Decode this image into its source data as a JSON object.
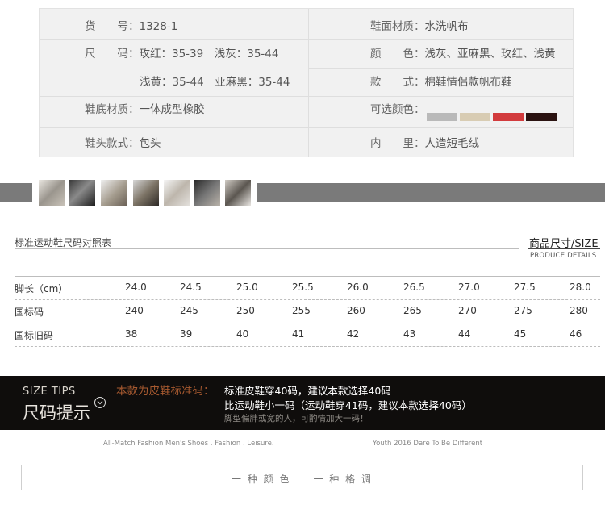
{
  "spec": {
    "item_no": {
      "label": "货　　号：",
      "value": "1328-1"
    },
    "upper": {
      "label": "鞋面材质：",
      "value": "水洗帆布"
    },
    "size": {
      "label": "尺　　码：",
      "value": "玫红：35-39　浅灰：35-44"
    },
    "size2": {
      "value": "浅黄：35-44　亚麻黑：35-44"
    },
    "color": {
      "label": "颜　　色：",
      "value": "浅灰、亚麻黑、玫红、浅黄"
    },
    "style": {
      "label": "款　　式：",
      "value": "棉鞋情侣款帆布鞋"
    },
    "sole": {
      "label": "鞋底材质：",
      "value": "一体成型橡胶"
    },
    "options": {
      "label": "可选颜色："
    },
    "toe": {
      "label": "鞋头款式：",
      "value": "包头"
    },
    "lining": {
      "label": "内　　里：",
      "value": "人造短毛绒"
    },
    "swatches": [
      "#b9b9b9",
      "#d8ccb3",
      "#d23b3d",
      "#2b1311"
    ]
  },
  "size_chart": {
    "title": "标准运动鞋尺码对照表",
    "right_title": "商品尺寸/SIZE",
    "right_sub": "PRODUCE DETAILS",
    "rows": [
      {
        "label": "脚长（cm）",
        "values": [
          "24.0",
          "24.5",
          "25.0",
          "25.5",
          "26.0",
          "26.5",
          "27.0",
          "27.5",
          "28.0"
        ]
      },
      {
        "label": "国标码",
        "values": [
          "240",
          "245",
          "250",
          "255",
          "260",
          "265",
          "270",
          "275",
          "280"
        ]
      },
      {
        "label": "国标旧码",
        "values": [
          "38",
          "39",
          "40",
          "41",
          "42",
          "43",
          "44",
          "45",
          "46"
        ]
      }
    ]
  },
  "tips": {
    "en": "SIZE TIPS",
    "cn": "尺码提示",
    "icon": "chevron-down-circle-icon",
    "headline": "本款为皮鞋标准码：",
    "line1": "标准皮鞋穿40码，建议本款选择40码",
    "line2": "比运动鞋小一码（运动鞋穿41码，建议本款选择40码）",
    "line3": "脚型偏胖或宽的人，可酌情加大一码！"
  },
  "footer": {
    "left": "All-Match  Fashion  Men's Shoes  .  Fashion  .  Leisure.",
    "right": "Youth 2016 Dare To Be Different",
    "box": "一 种 颜 色　　一 种 格 调"
  }
}
